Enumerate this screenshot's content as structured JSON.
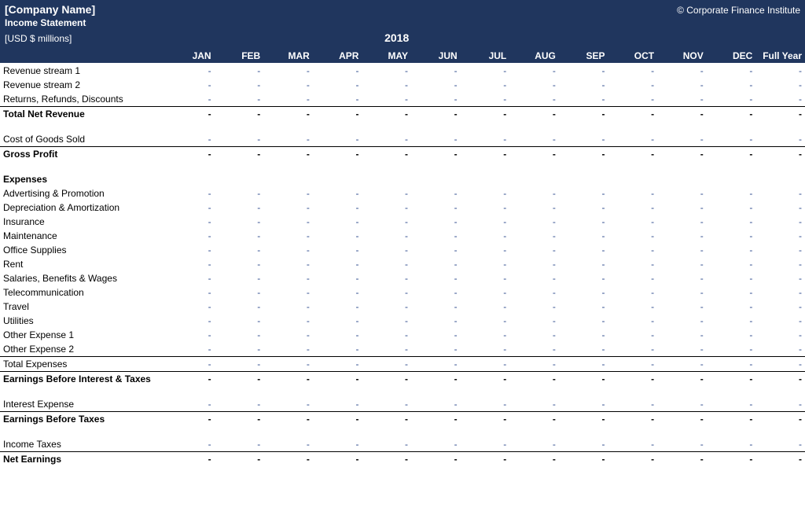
{
  "header": {
    "company": "[Company Name]",
    "copyright": "© Corporate Finance Institute",
    "subtitle": "Income Statement",
    "units": "[USD $ millions]",
    "year": "2018"
  },
  "columns": [
    "JAN",
    "FEB",
    "MAR",
    "APR",
    "MAY",
    "JUN",
    "JUL",
    "AUG",
    "SEP",
    "OCT",
    "NOV",
    "DEC",
    "Full Year"
  ],
  "rows": [
    {
      "label": "Revenue stream 1",
      "type": "input"
    },
    {
      "label": "Revenue stream 2",
      "type": "input"
    },
    {
      "label": "Returns, Refunds, Discounts",
      "type": "input",
      "underline": true
    },
    {
      "label": "Total Net Revenue",
      "type": "total"
    },
    {
      "label": "",
      "type": "spacer"
    },
    {
      "label": "Cost of Goods Sold",
      "type": "input",
      "underline": true
    },
    {
      "label": "Gross Profit",
      "type": "total"
    },
    {
      "label": "",
      "type": "spacer"
    },
    {
      "label": "Expenses",
      "type": "section"
    },
    {
      "label": "Advertising & Promotion",
      "type": "input"
    },
    {
      "label": "Depreciation & Amortization",
      "type": "input"
    },
    {
      "label": "Insurance",
      "type": "input"
    },
    {
      "label": "Maintenance",
      "type": "input"
    },
    {
      "label": "Office Supplies",
      "type": "input"
    },
    {
      "label": "Rent",
      "type": "input"
    },
    {
      "label": "Salaries, Benefits & Wages",
      "type": "input"
    },
    {
      "label": "Telecommunication",
      "type": "input"
    },
    {
      "label": "Travel",
      "type": "input"
    },
    {
      "label": "Utilities",
      "type": "input"
    },
    {
      "label": "Other Expense 1",
      "type": "input"
    },
    {
      "label": "Other Expense 2",
      "type": "input",
      "underline": true
    },
    {
      "label": "Total Expenses",
      "type": "subtotal",
      "underline": true
    },
    {
      "label": "Earnings Before Interest & Taxes",
      "type": "total"
    },
    {
      "label": "",
      "type": "spacer"
    },
    {
      "label": "Interest Expense",
      "type": "input",
      "underline": true
    },
    {
      "label": "Earnings Before Taxes",
      "type": "total"
    },
    {
      "label": "",
      "type": "spacer"
    },
    {
      "label": "Income Taxes",
      "type": "input",
      "underline": true
    },
    {
      "label": "Net Earnings",
      "type": "total",
      "dbltop": true
    }
  ],
  "dash": "-"
}
